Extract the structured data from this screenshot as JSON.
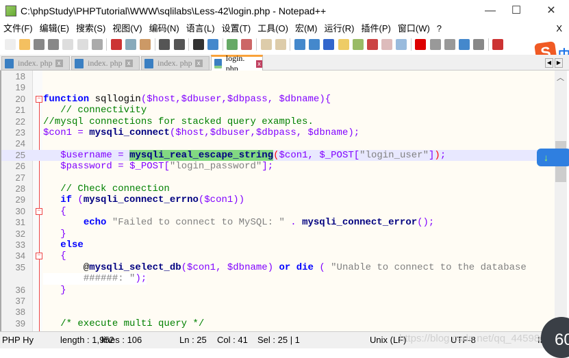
{
  "window": {
    "title": "C:\\phpStudy\\PHPTutorial\\WWW\\sqlilabs\\Less-42\\login.php - Notepad++",
    "minimize": "—",
    "maximize": "☐",
    "close": "✕"
  },
  "menu": [
    "文件(F)",
    "编辑(E)",
    "搜索(S)",
    "视图(V)",
    "编码(N)",
    "语言(L)",
    "设置(T)",
    "工具(O)",
    "宏(M)",
    "运行(R)",
    "插件(P)",
    "窗口(W)",
    "?"
  ],
  "menu_close": "X",
  "tabs": [
    {
      "label": "index. php",
      "active": false
    },
    {
      "label": "index. php",
      "active": false
    },
    {
      "label": "index. php",
      "active": false
    },
    {
      "label": "login. php",
      "active": true
    }
  ],
  "ime": {
    "logo": "S",
    "mode": "中"
  },
  "code": [
    {
      "n": "18",
      "t": []
    },
    {
      "n": "19",
      "t": []
    },
    {
      "n": "20",
      "fold": "open",
      "t": [
        [
          "function",
          "kw"
        ],
        [
          " sqllogin",
          "pl"
        ],
        [
          "(",
          "op"
        ],
        [
          "$host",
          "var"
        ],
        [
          ",",
          "op"
        ],
        [
          "$dbuser",
          "var"
        ],
        [
          ",",
          "op"
        ],
        [
          "$dbpass",
          "var"
        ],
        [
          ", ",
          "op"
        ],
        [
          "$dbname",
          "var"
        ],
        [
          "){",
          "op"
        ]
      ]
    },
    {
      "n": "21",
      "t": [
        [
          "   // connectivity",
          "cm"
        ]
      ]
    },
    {
      "n": "22",
      "t": [
        [
          "//mysql connections for stacked query examples.",
          "cm"
        ]
      ]
    },
    {
      "n": "23",
      "t": [
        [
          "$con1",
          "var"
        ],
        [
          " = ",
          "op"
        ],
        [
          "mysqli_connect",
          "fn"
        ],
        [
          "(",
          "op"
        ],
        [
          "$host",
          "var"
        ],
        [
          ",",
          "op"
        ],
        [
          "$dbuser",
          "var"
        ],
        [
          ",",
          "op"
        ],
        [
          "$dbpass",
          "var"
        ],
        [
          ", ",
          "op"
        ],
        [
          "$dbname",
          "var"
        ],
        [
          ");",
          "op"
        ]
      ]
    },
    {
      "n": "24",
      "t": []
    },
    {
      "n": "25",
      "cur": true,
      "t": [
        [
          "   ",
          "pl"
        ],
        [
          "$username",
          "var"
        ],
        [
          " = ",
          "op"
        ],
        [
          "mysqli_real_escape_string",
          "fn hl"
        ],
        [
          "(",
          "br"
        ],
        [
          "$con1",
          "var"
        ],
        [
          ", ",
          "op"
        ],
        [
          "$_POST",
          "var"
        ],
        [
          "[",
          "op"
        ],
        [
          "\"login_user\"",
          "str"
        ],
        [
          "]",
          "op"
        ],
        [
          ")",
          "br"
        ],
        [
          ";",
          "op"
        ]
      ]
    },
    {
      "n": "26",
      "t": [
        [
          "   ",
          "pl"
        ],
        [
          "$password",
          "var"
        ],
        [
          " = ",
          "op"
        ],
        [
          "$_POST",
          "var"
        ],
        [
          "[",
          "op"
        ],
        [
          "\"login_password\"",
          "str"
        ],
        [
          "];",
          "op"
        ]
      ]
    },
    {
      "n": "27",
      "t": []
    },
    {
      "n": "28",
      "t": [
        [
          "   // Check connection",
          "cm"
        ]
      ]
    },
    {
      "n": "29",
      "t": [
        [
          "   ",
          "pl"
        ],
        [
          "if",
          "kw"
        ],
        [
          " (",
          "op"
        ],
        [
          "mysqli_connect_errno",
          "fn"
        ],
        [
          "(",
          "op"
        ],
        [
          "$con1",
          "var"
        ],
        [
          "))",
          "op"
        ]
      ]
    },
    {
      "n": "30",
      "fold": "open",
      "t": [
        [
          "   {",
          "op"
        ]
      ]
    },
    {
      "n": "31",
      "t": [
        [
          "       ",
          "pl"
        ],
        [
          "echo",
          "kw"
        ],
        [
          " ",
          "pl"
        ],
        [
          "\"Failed to connect to MySQL: \"",
          "str"
        ],
        [
          " . ",
          "op"
        ],
        [
          "mysqli_connect_error",
          "fn"
        ],
        [
          "();",
          "op"
        ]
      ]
    },
    {
      "n": "32",
      "t": [
        [
          "   }",
          "op"
        ]
      ]
    },
    {
      "n": "33",
      "t": [
        [
          "   ",
          "pl"
        ],
        [
          "else",
          "kw"
        ]
      ]
    },
    {
      "n": "34",
      "fold": "open",
      "t": [
        [
          "   {",
          "op"
        ]
      ]
    },
    {
      "n": "35",
      "t": [
        [
          "       @",
          "pl"
        ],
        [
          "mysqli_select_db",
          "fn"
        ],
        [
          "(",
          "op"
        ],
        [
          "$con1",
          "var"
        ],
        [
          ", ",
          "op"
        ],
        [
          "$dbname",
          "var"
        ],
        [
          ") ",
          "op"
        ],
        [
          "or",
          "kw"
        ],
        [
          " ",
          "pl"
        ],
        [
          "die",
          "kw"
        ],
        [
          " ( ",
          "op"
        ],
        [
          "\"Unable to connect to the database",
          "str"
        ]
      ]
    },
    {
      "n": "",
      "t": [
        [
          "       ",
          "pl"
        ],
        [
          "######: \"",
          "str"
        ],
        [
          ");",
          "op"
        ]
      ]
    },
    {
      "n": "36",
      "t": [
        [
          "   }",
          "op"
        ]
      ]
    },
    {
      "n": "37",
      "t": []
    },
    {
      "n": "38",
      "t": []
    },
    {
      "n": "39",
      "t": [
        [
          "   /* execute multi query */",
          "cm"
        ]
      ]
    }
  ],
  "status": {
    "lang": "PHP Hy",
    "length": "length : 1,952",
    "lines": "lines : 106",
    "ln": "Ln : 25",
    "col": "Col : 41",
    "sel": "Sel : 25 | 1",
    "eol": "Unix (LF)",
    "enc": "UTF-8",
    "ins": "IN",
    "watermark": "https://blog.csdn.net/qq_44598397",
    "badge": "60"
  }
}
